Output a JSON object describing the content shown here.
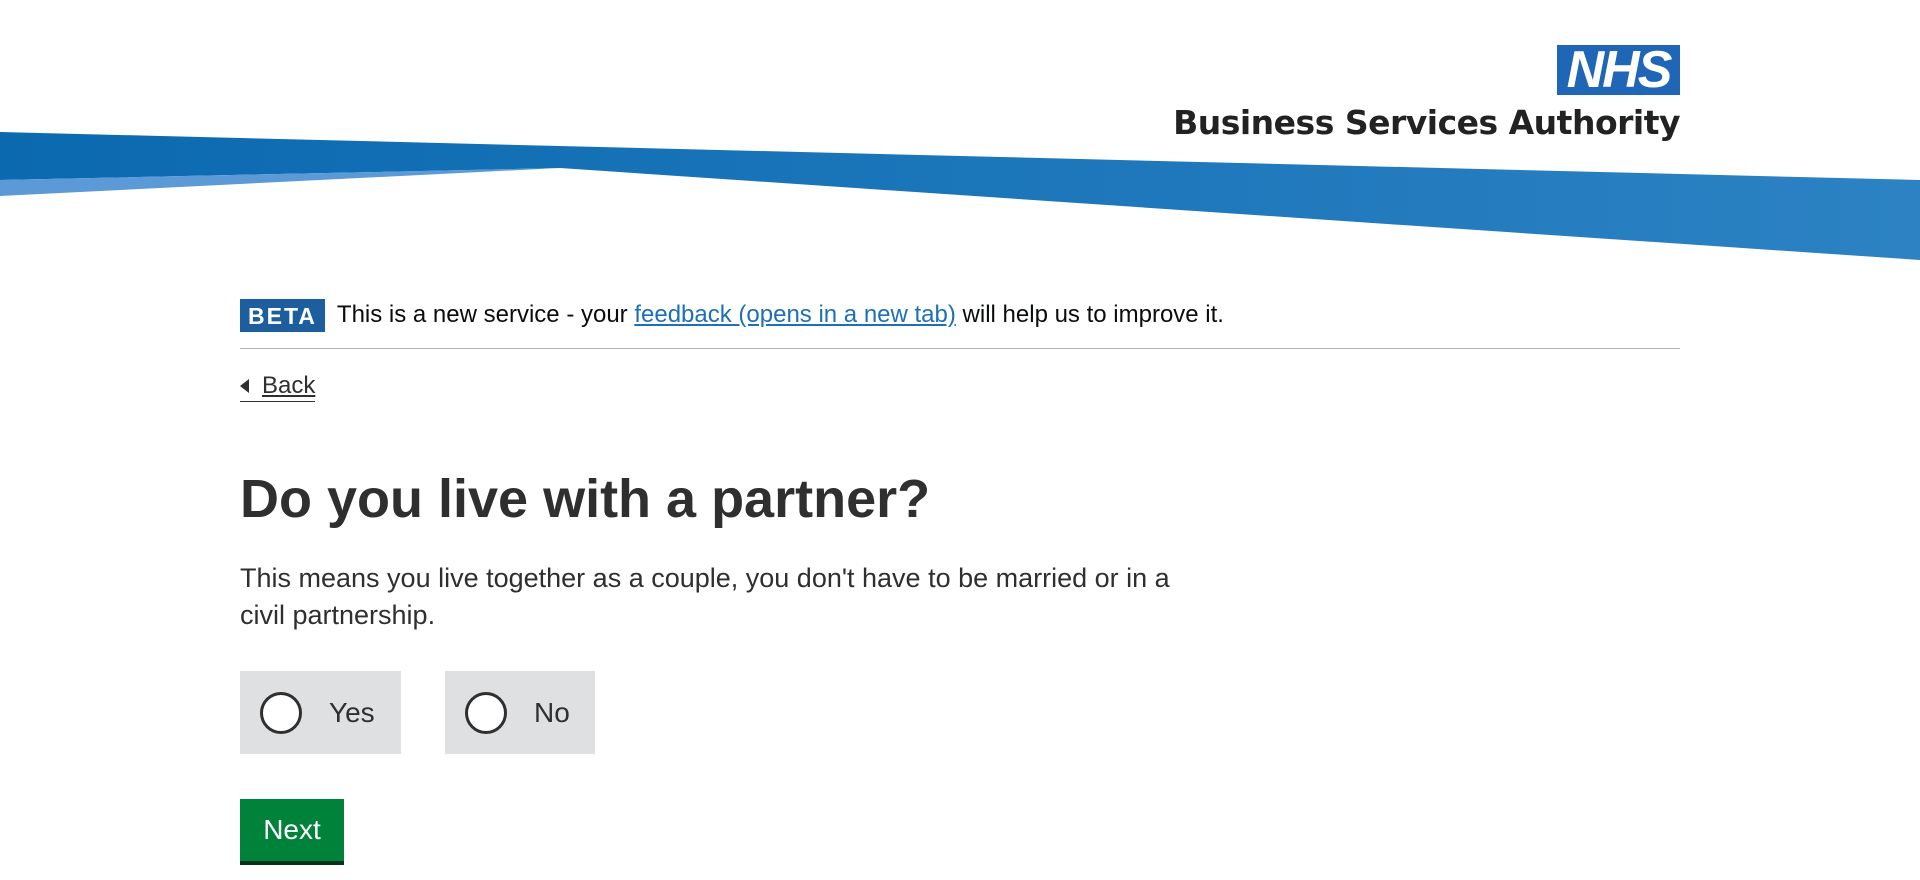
{
  "header": {
    "logo_nhs": "NHS",
    "logo_org": "Business Services Authority",
    "banner_colors": {
      "dark": "#0f6db3",
      "light": "#5b9ad6",
      "end": "#2b7fc1"
    }
  },
  "phase_banner": {
    "tag": "BETA",
    "text_before": "This is a new service - your ",
    "link_text": "feedback (opens in a new tab)",
    "text_after": " will help us to improve it."
  },
  "back_link": {
    "label": "Back"
  },
  "question": {
    "title": "Do you live with a partner?",
    "hint": "This means you live together as a couple, you don't have to be married or in a civil partnership."
  },
  "options": [
    {
      "label": "Yes",
      "selected": false
    },
    {
      "label": "No",
      "selected": false
    }
  ],
  "actions": {
    "next_label": "Next"
  },
  "colors": {
    "accent": "#1d5e9e",
    "link": "#1d70b8",
    "button": "#00823b",
    "radio_bg": "#dee0e2"
  }
}
